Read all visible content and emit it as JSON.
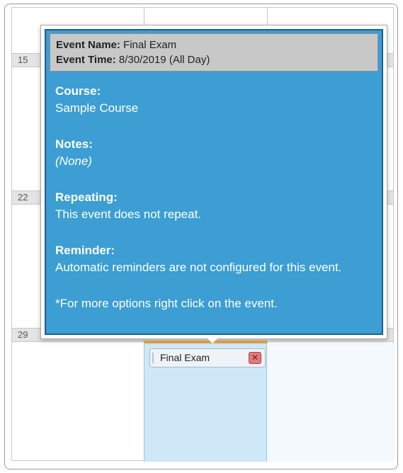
{
  "calendar": {
    "week_rows": [
      {
        "day": "15"
      },
      {
        "day": "22"
      },
      {
        "day": "29"
      }
    ],
    "event": {
      "title": "Final Exam",
      "delete_glyph": "✕",
      "delete_icon": "close-icon"
    }
  },
  "popup": {
    "event_name_label": "Event Name:",
    "event_name_value": "Final Exam",
    "event_time_label": "Event Time:",
    "event_time_value": "8/30/2019 (All Day)",
    "course_label": "Course:",
    "course_value": "Sample Course",
    "notes_label": "Notes:",
    "notes_value": "(None)",
    "repeating_label": "Repeating:",
    "repeating_value": "This event does not repeat.",
    "reminder_label": "Reminder:",
    "reminder_value": "Automatic reminders are not configured for this event.",
    "footer": "*For more options right click on the event."
  },
  "colors": {
    "popup_background": "#3c9ed2",
    "popup_header": "#c8c8c8",
    "selected_day": "#cfe8f7",
    "accent_strip": "#e9a74a"
  }
}
